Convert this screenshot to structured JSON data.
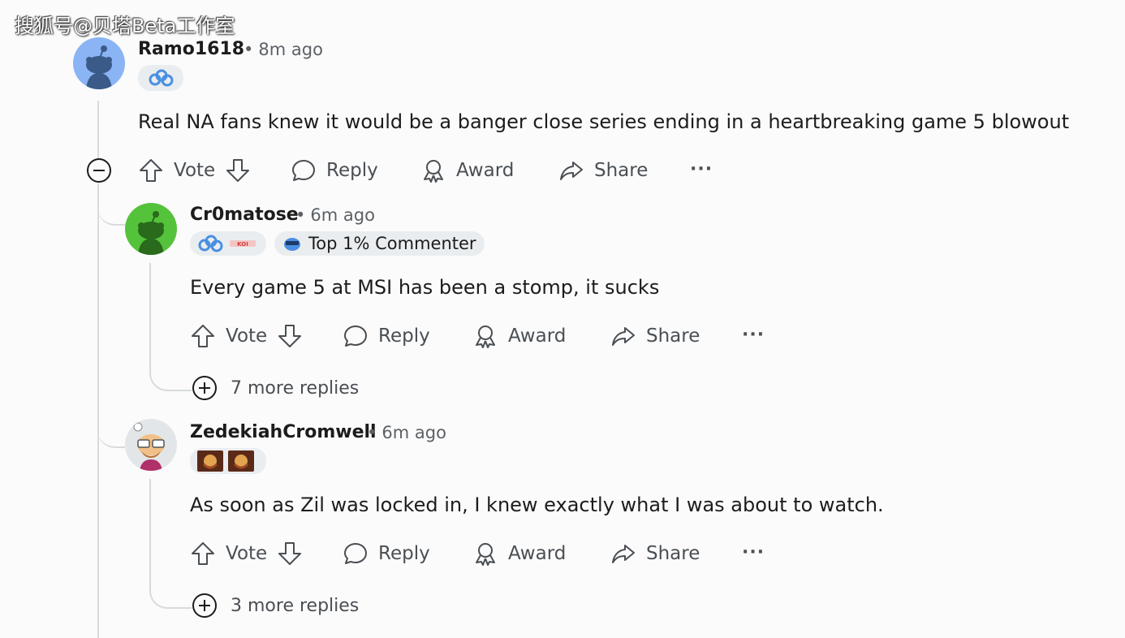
{
  "watermark": "搜狐号@贝塔Beta工作室",
  "comments": [
    {
      "username": "Ramo1618",
      "time": "8m ago",
      "flair": "cloud9-icon",
      "text": "Real NA fans knew it would be a banger close series ending in a heartbreaking game 5 blowout",
      "actions": {
        "vote": "Vote",
        "reply": "Reply",
        "award": "Award",
        "share": "Share",
        "more": "···"
      }
    },
    {
      "username": "Cr0matose",
      "time": "6m ago",
      "flair": "cloud9-team-flair",
      "badge": "Top 1% Commenter",
      "text": "Every game 5 at MSI has been a stomp, it sucks",
      "actions": {
        "vote": "Vote",
        "reply": "Reply",
        "award": "Award",
        "share": "Share",
        "more": "···"
      },
      "more_replies": "7 more replies"
    },
    {
      "username": "ZedekiahCromwell",
      "time": "6m ago",
      "flair": "champion-icons",
      "text": "As soon as Zil was locked in, I knew exactly what I was about to watch.",
      "actions": {
        "vote": "Vote",
        "reply": "Reply",
        "award": "Award",
        "share": "Share",
        "more": "···"
      },
      "more_replies": "3 more replies"
    }
  ],
  "colors": {
    "accent_blue": "#4a90e2",
    "avatar_blue": "#8ab4f4",
    "avatar_green": "#55c23b"
  }
}
